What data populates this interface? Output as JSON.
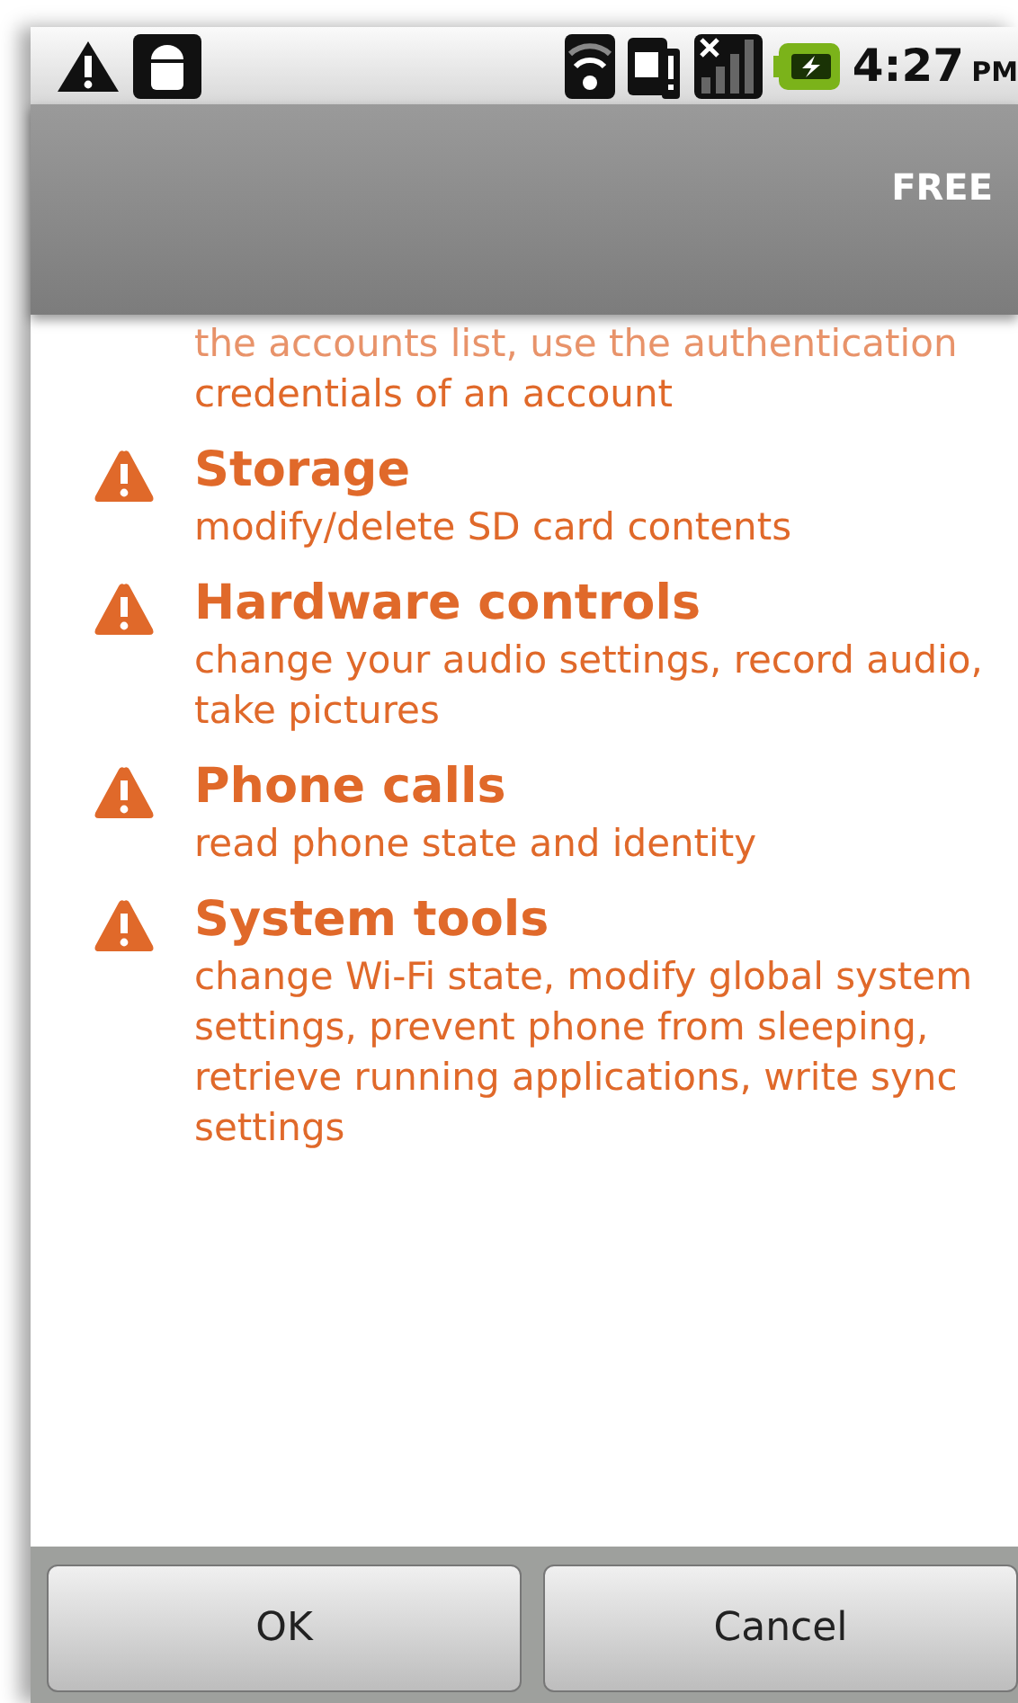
{
  "status_bar": {
    "time": "4:27",
    "meridiem": "PM"
  },
  "title_bar": {
    "title": "FREE"
  },
  "permissions_top": {
    "partial_line": "the accounts list, use the authentication",
    "last_line": "credentials of an account"
  },
  "permissions": [
    {
      "title": "Storage",
      "description": "modify/delete SD card contents"
    },
    {
      "title": "Hardware controls",
      "description": "change your audio settings, record audio, take pictures"
    },
    {
      "title": "Phone calls",
      "description": "read phone state and identity"
    },
    {
      "title": "System tools",
      "description": "change Wi-Fi state, modify global system settings, prevent phone from sleeping, retrieve running applications, write sync settings"
    }
  ],
  "buttons": [
    "OK",
    "Cancel"
  ]
}
